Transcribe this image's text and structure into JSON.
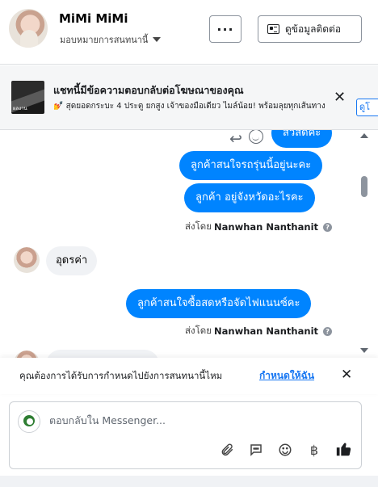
{
  "header": {
    "name": "MiMi MiMi",
    "assign_label": "มอบหมายการสนทนานี้",
    "more_label": "···",
    "contact_label": "ดูข้อมูลติดต่อ"
  },
  "banner": {
    "title": "แชทนี้มีข้อความตอบกลับต่อโฆษณาของคุณ",
    "subtitle": "💅 สุดยอดกระบะ 4 ประตู ยกสูง เจ้าของมือเดียว ไมล์น้อย! พร้อมลุยทุกเส้นทาง",
    "cta": "ดูโ",
    "close": "✕"
  },
  "messages": {
    "m1": "สวัสดีค่ะ",
    "m2": "ลูกค้าสนใจรถรุ่นนี้อยู่นะคะ",
    "m3": "ลูกค้า   อยู่จังหวัดอะไรคะ",
    "sent_by_label": "ส่งโดย",
    "sender": "Nanwhan Nanthanit",
    "in1": "อุดรค่า",
    "m4": "ลูกค้าสนใจซื้อสดหรือจัดไฟแนนซ์คะ"
  },
  "assign_prompt": {
    "text": "คุณต้องการได้รับการกำหนดไปยังการสนทนานี้ไหม",
    "link": "กำหนดให้ฉัน",
    "close": "✕"
  },
  "composer": {
    "placeholder": "ตอบกลับใน Messenger...",
    "currency": "฿"
  },
  "colors": {
    "accent": "#0084ff",
    "link": "#1877f2"
  },
  "icons": [
    "more-icon",
    "id-card-icon",
    "close-icon",
    "reply-icon",
    "emoji-reaction-icon",
    "help-icon",
    "attachment-icon",
    "saved-reply-icon",
    "emoji-icon",
    "baht-icon",
    "thumbs-up-icon"
  ]
}
